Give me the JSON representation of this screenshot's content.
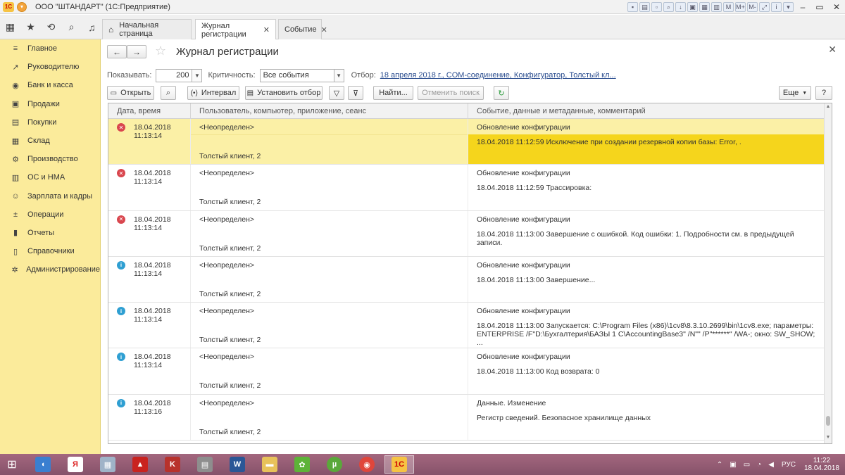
{
  "window": {
    "title": "ООО \"ШТАНДАРТ\"  (1С:Предприятие)"
  },
  "tabs": [
    {
      "label": "Начальная страница"
    },
    {
      "label": "Журнал регистрации"
    },
    {
      "label": "Событие"
    }
  ],
  "sidebar": {
    "items": [
      {
        "label": "Главное",
        "icon": "menu-lines-icon"
      },
      {
        "label": "Руководителю",
        "icon": "trend-icon"
      },
      {
        "label": "Банк и касса",
        "icon": "coin-icon"
      },
      {
        "label": "Продажи",
        "icon": "cart-icon"
      },
      {
        "label": "Покупки",
        "icon": "basket-icon"
      },
      {
        "label": "Склад",
        "icon": "warehouse-icon"
      },
      {
        "label": "Производство",
        "icon": "factory-icon"
      },
      {
        "label": "ОС и НМА",
        "icon": "assets-icon"
      },
      {
        "label": "Зарплата и кадры",
        "icon": "people-icon"
      },
      {
        "label": "Операции",
        "icon": "operations-icon"
      },
      {
        "label": "Отчеты",
        "icon": "report-icon"
      },
      {
        "label": "Справочники",
        "icon": "book-icon"
      },
      {
        "label": "Администрирование",
        "icon": "gear-icon"
      }
    ]
  },
  "page": {
    "title": "Журнал регистрации"
  },
  "filters": {
    "show_label": "Показывать:",
    "show_value": "200",
    "criticality_label": "Критичность:",
    "criticality_value": "Все события",
    "otbor_label": "Отбор:",
    "otbor_value": "18 апреля 2018 г., COM-соединение, Конфигуратор, Толстый кл..."
  },
  "toolbar": {
    "open": "Открыть",
    "interval": "Интервал",
    "set_filter": "Установить отбор",
    "find": "Найти...",
    "cancel_search": "Отменить поиск",
    "more": "Еще",
    "help": "?"
  },
  "grid": {
    "columns": [
      "Дата, время",
      "Пользователь, компьютер, приложение, сеанс",
      "Событие, данные и метаданные, комментарий"
    ],
    "rows": [
      {
        "level": "error",
        "date": "18.04.2018",
        "time": "11:13:14",
        "user": "<Неопределен>",
        "session": "Толстый клиент, 2",
        "event": "Обновление конфигурации",
        "data": "18.04.2018 11:12:59 Исключение при создании резервной копии базы: Error, ."
      },
      {
        "level": "error",
        "date": "18.04.2018",
        "time": "11:13:14",
        "user": "<Неопределен>",
        "session": "Толстый клиент, 2",
        "event": "Обновление конфигурации",
        "data": "18.04.2018 11:12:59 Трассировка:"
      },
      {
        "level": "error",
        "date": "18.04.2018",
        "time": "11:13:14",
        "user": "<Неопределен>",
        "session": "Толстый клиент, 2",
        "event": "Обновление конфигурации",
        "data": "18.04.2018 11:13:00 Завершение с ошибкой. Код ошибки: 1. Подробности см. в предыдущей записи."
      },
      {
        "level": "info",
        "date": "18.04.2018",
        "time": "11:13:14",
        "user": "<Неопределен>",
        "session": "Толстый клиент, 2",
        "event": "Обновление конфигурации",
        "data": "18.04.2018 11:13:00 Завершение..."
      },
      {
        "level": "info",
        "date": "18.04.2018",
        "time": "11:13:14",
        "user": "<Неопределен>",
        "session": "Толстый клиент, 2",
        "event": "Обновление конфигурации",
        "data": "18.04.2018 11:13:00 Запускается: C:\\Program Files (x86)\\1cv8\\8.3.10.2699\\bin\\1cv8.exe; параметры:\nENTERPRISE /F\"D:\\Бухгалтерия\\БАЗЫ 1 С\\AccountingBase3\" /N\"\" /P\"******\" /WA-; окно: SW_SHOW; ..."
      },
      {
        "level": "info",
        "date": "18.04.2018",
        "time": "11:13:14",
        "user": "<Неопределен>",
        "session": "Толстый клиент, 2",
        "event": "Обновление конфигурации",
        "data": "18.04.2018 11:13:00 Код возврата: 0"
      },
      {
        "level": "info",
        "date": "18.04.2018",
        "time": "11:13:16",
        "user": "<Неопределен>",
        "session": "Толстый клиент, 2",
        "event": "Данные. Изменение",
        "data": "Регистр сведений. Безопасное хранилище данных"
      }
    ]
  },
  "taskbar": {
    "lang": "РУС",
    "time": "11:22",
    "date": "18.04.2018"
  },
  "colors": {
    "sidebar": "#fbeb9b",
    "selected_row": "#fbf0a6",
    "highlight": "#f5d51c",
    "error": "#d9464e",
    "info": "#2f9fd2"
  }
}
